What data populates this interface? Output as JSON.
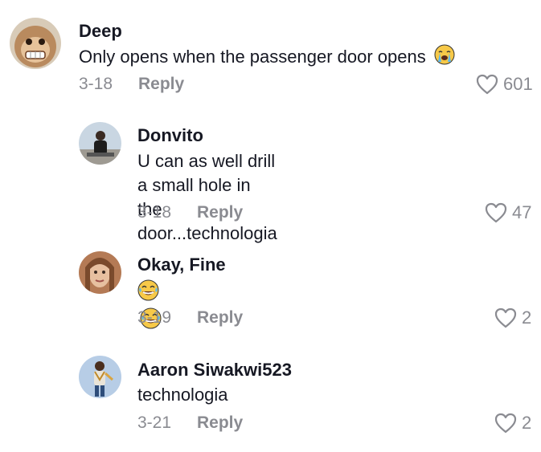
{
  "comments": [
    {
      "username": "Deep",
      "text": "Only opens when the passenger door opens",
      "emoji_after": "loudly-crying-face",
      "date": "3-18",
      "reply_label": "Reply",
      "likes": "601"
    },
    {
      "username": "Donvito",
      "text_line1": "U can as well drill a small hole in the",
      "text_line2": "door...technologia",
      "date": "3-18",
      "reply_label": "Reply",
      "likes": "47"
    },
    {
      "username": "Okay, Fine",
      "emojis": [
        "face-with-tears-of-joy",
        "face-with-tears-of-joy"
      ],
      "date": "3-19",
      "reply_label": "Reply",
      "likes": "2"
    },
    {
      "username": "Aaron Siwakwi523",
      "text": "technologia",
      "date": "3-21",
      "reply_label": "Reply",
      "likes": "2"
    }
  ],
  "colors": {
    "text": "#161823",
    "muted": "#8a8b91",
    "background": "#ffffff"
  }
}
